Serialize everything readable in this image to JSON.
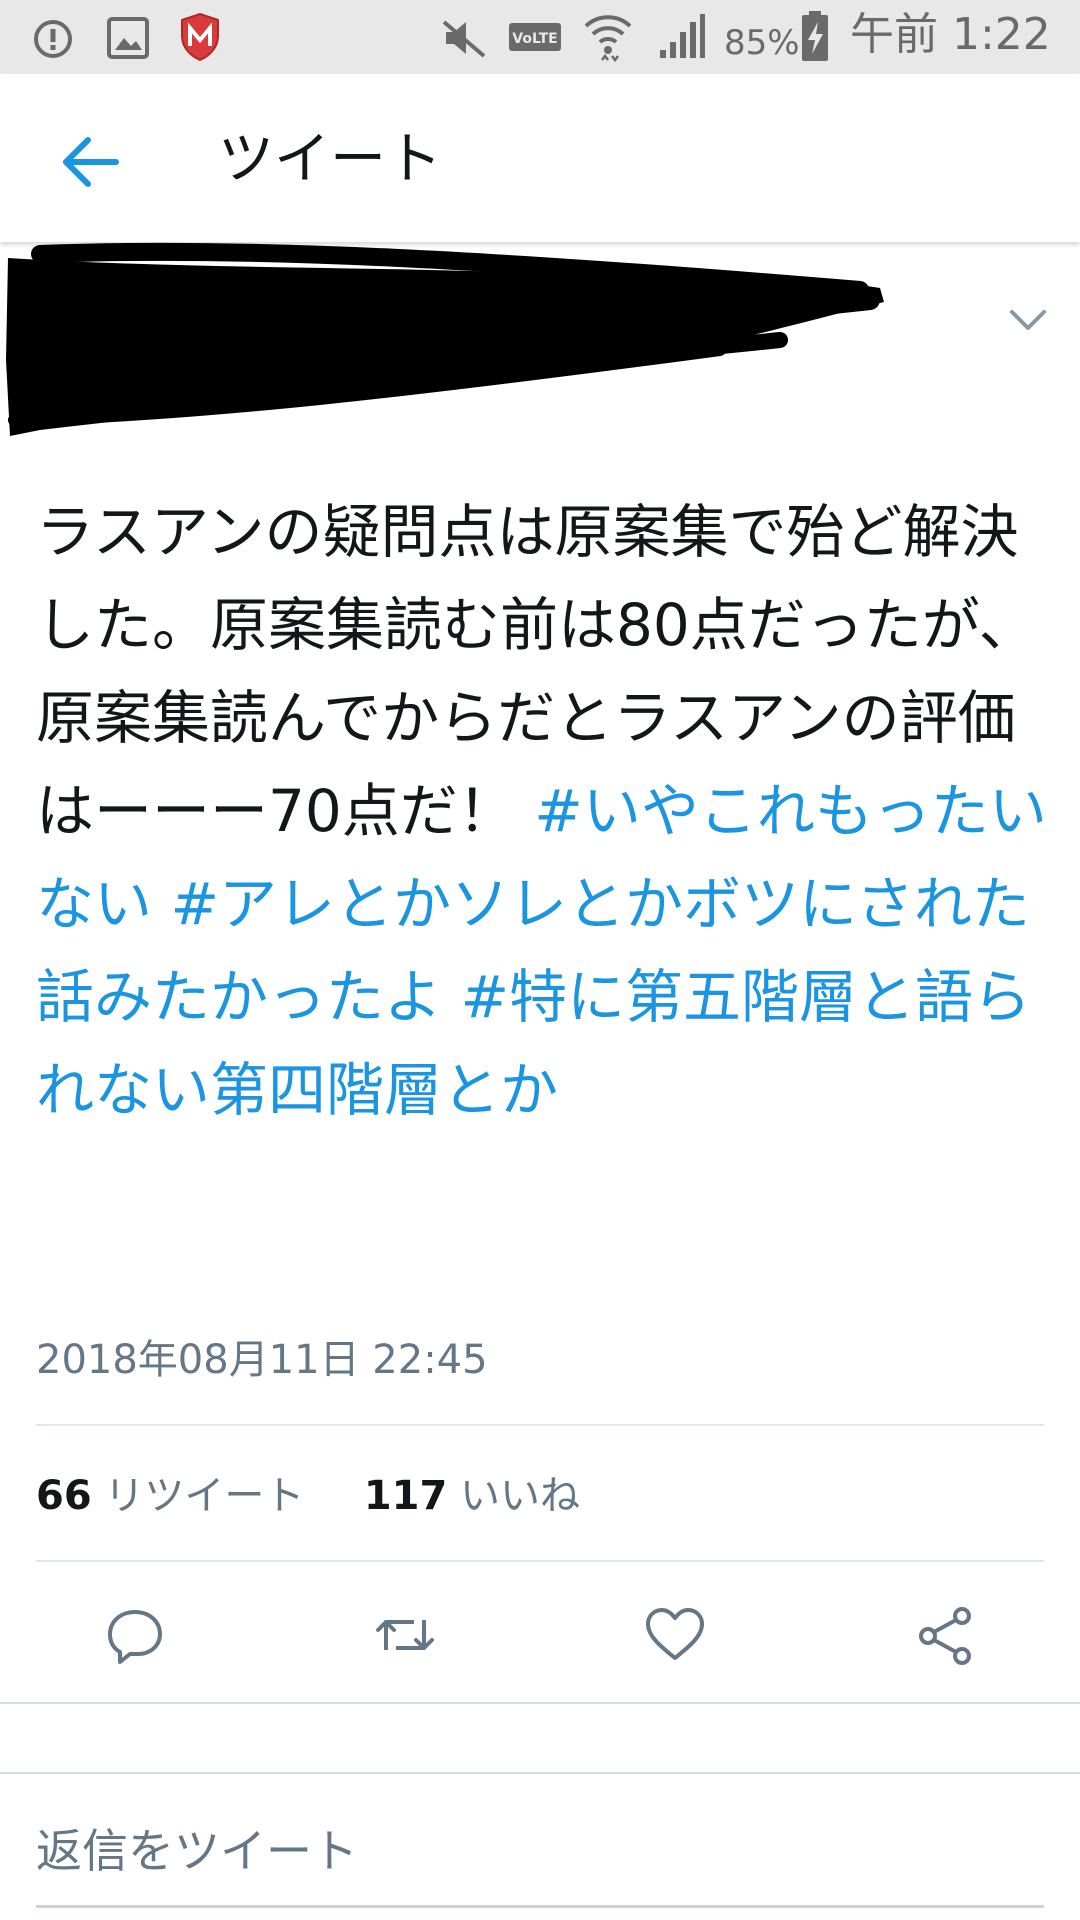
{
  "status_bar": {
    "icons": [
      "info-icon",
      "image-icon",
      "mcafee-icon",
      "mute-icon",
      "volte-icon",
      "wifi-icon",
      "signal-icon",
      "battery-charging-icon"
    ],
    "volte_label": "VoLTE",
    "battery_percent": "85%",
    "time": "午前 1:22"
  },
  "header": {
    "title": "ツイート",
    "back_icon": "arrow-left-icon"
  },
  "tweet": {
    "body_text": "ラスアンの疑問点は原案集で殆ど解決した。原案集読む前は80点だったが、原案集読んでからだとラスアンの評価はーーー70点だ！ ",
    "hashtags": [
      "#いやこれもったいない",
      "#アレとかソレとかボツにされた話みたかったよ",
      "#特に第五階層と語られない第四階層とか"
    ],
    "timestamp": "2018年08月11日 22:45",
    "retweet_count": "66",
    "retweet_label": "リツイート",
    "like_count": "117",
    "like_label": "いいね",
    "actions": [
      "reply-icon",
      "retweet-icon",
      "like-icon",
      "share-icon"
    ]
  },
  "reply": {
    "placeholder": "返信をツイート"
  },
  "colors": {
    "link": "#1b95e0",
    "text": "#14171a",
    "muted": "#657786",
    "status_bar_bg": "#e8e8e8"
  }
}
